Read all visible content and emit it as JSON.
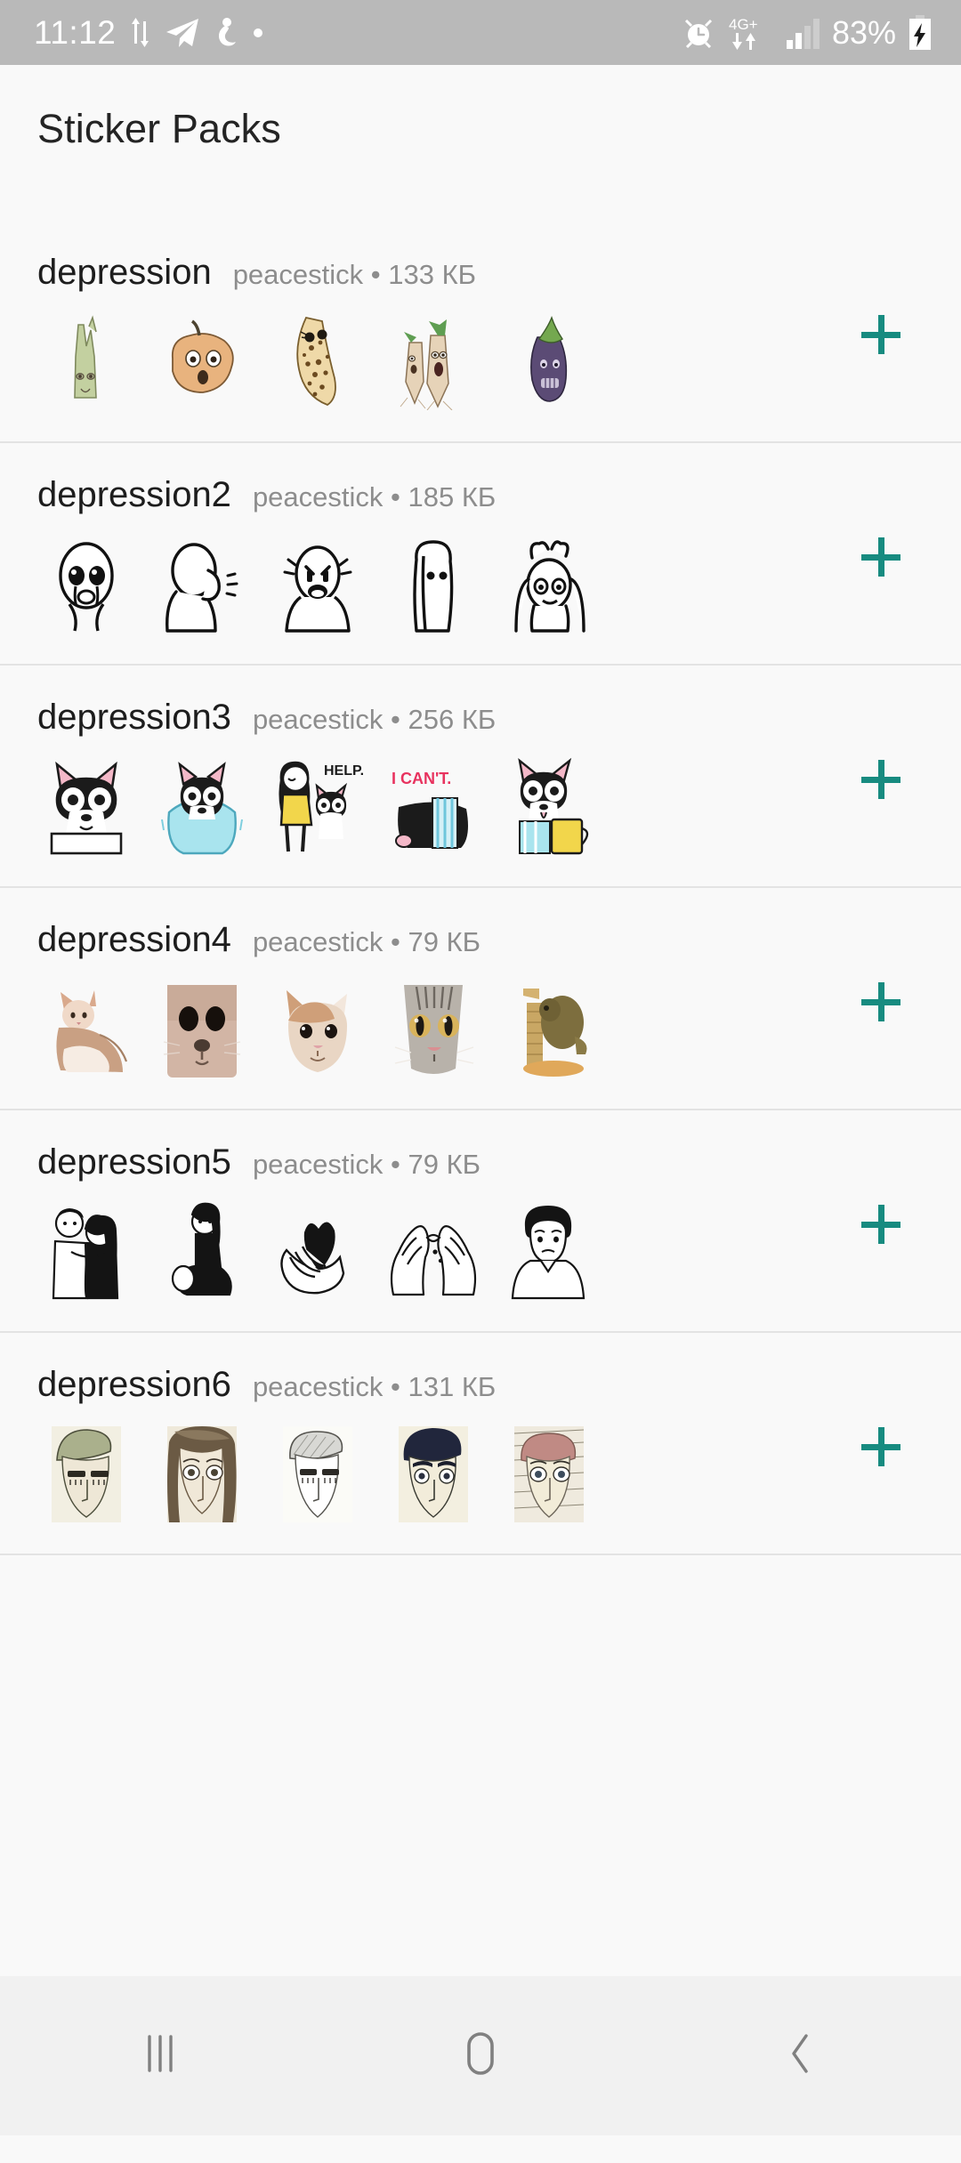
{
  "status_bar": {
    "time": "11:12",
    "left_icons": [
      "data-transfer-icon",
      "telegram-icon",
      "app-notification-icon",
      "dot-icon"
    ],
    "right_icons": [
      "alarm-icon",
      "network-4gplus-icon",
      "signal-bars-icon"
    ],
    "network_label": "4G+",
    "battery_percent": "83%",
    "battery_icon": "battery-charging-icon",
    "background_color": "#b9b9b9",
    "text_color": "#ffffff"
  },
  "header": {
    "title": "Sticker Packs"
  },
  "theme": {
    "accent_color": "#178b80",
    "page_background": "#f9f9f9",
    "divider_color": "#e3e3e3",
    "nav_background": "#f1f1f1",
    "primary_text": "#1d1d1d",
    "secondary_text": "#8d8d8d"
  },
  "packs": [
    {
      "name": "depression",
      "author": "peacestick",
      "separator": "•",
      "size": "133 КБ",
      "meta": "peacestick • 133 КБ",
      "add_label": "+",
      "stickers": [
        "celery-sad-sticker",
        "potato-scared-sticker",
        "banana-spotted-sticker",
        "parsnips-crying-sticker",
        "eggplant-gloomy-sticker"
      ]
    },
    {
      "name": "depression2",
      "author": "peacestick",
      "separator": "•",
      "size": "185 КБ",
      "meta": "peacestick • 185 КБ",
      "add_label": "+",
      "stickers": [
        "face-crying-sticker",
        "figure-facepalm-sticker",
        "figure-angry-sticker",
        "figure-hiding-sticker",
        "figure-head-grab-sticker"
      ]
    },
    {
      "name": "depression3",
      "author": "peacestick",
      "separator": "•",
      "size": "256 КБ",
      "meta": "peacestick • 256 КБ",
      "add_label": "+",
      "stickers": [
        "bulldog-peeking-sticker",
        "bulldog-blanket-sticker",
        "girl-holding-dog-help-sticker",
        "dog-hiding-i-cant-sticker",
        "bulldog-mug-sticker"
      ]
    },
    {
      "name": "depression4",
      "author": "peacestick",
      "separator": "•",
      "size": "79 КБ",
      "meta": "peacestick • 79 КБ",
      "add_label": "+",
      "stickers": [
        "cat-sitting-photo-sticker",
        "cat-closeup-photo-sticker",
        "cat-staring-photo-sticker",
        "tabby-face-photo-sticker",
        "cat-tower-photo-sticker"
      ]
    },
    {
      "name": "depression5",
      "author": "peacestick",
      "separator": "•",
      "size": "79 КБ",
      "meta": "peacestick • 79 КБ",
      "add_label": "+",
      "stickers": [
        "couple-hugging-sticker",
        "woman-sitting-sticker",
        "hands-holding-heart-sticker",
        "pinky-promise-hands-sticker",
        "sad-man-sticker"
      ]
    },
    {
      "name": "depression6",
      "author": "peacestick",
      "separator": "•",
      "size": "131 КБ",
      "meta": "peacestick • 131 КБ",
      "add_label": "+",
      "stickers": [
        "pencil-face-green-hair-sticker",
        "pencil-face-long-hair-sticker",
        "pencil-face-sketch-sticker",
        "pencil-face-dark-hair-sticker",
        "pencil-face-red-hair-sticker"
      ]
    }
  ],
  "nav_bar": {
    "recents_label": "recents-icon",
    "home_label": "home-icon",
    "back_label": "back-icon"
  }
}
